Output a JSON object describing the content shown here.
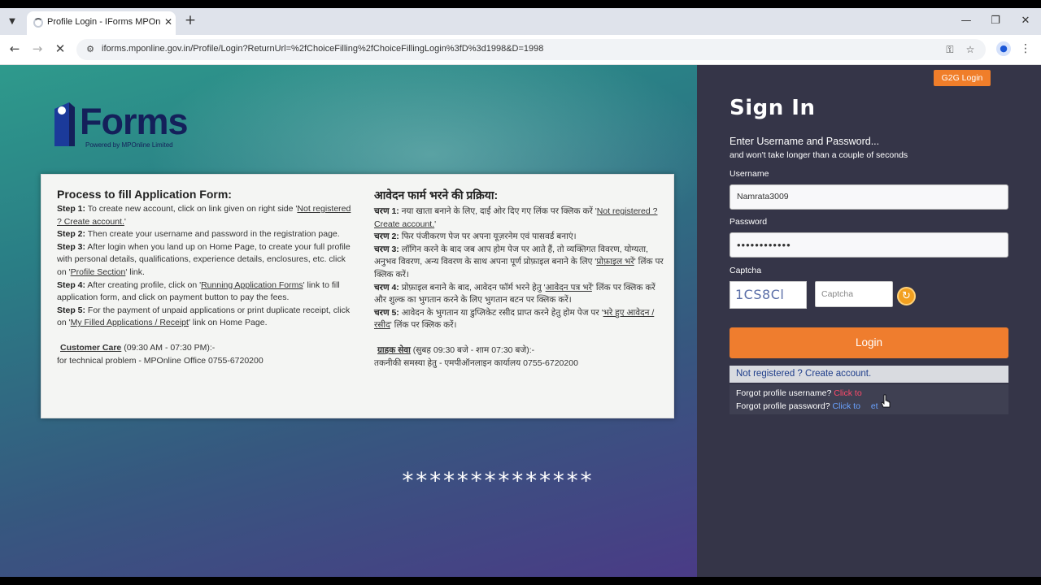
{
  "browser": {
    "tab_title": "Profile Login - IForms MPOnline",
    "tab_close": "✕",
    "new_tab": "+",
    "url": "iforms.mponline.gov.in/Profile/Login?ReturnUrl=%2fChoiceFilling%2fChoiceFillingLogin%3fD%3d1998&D=1998"
  },
  "logo": {
    "text": "Forms",
    "tagline": "Powered by MPOnline Limited",
    "colors": {
      "i_blue": "#1b3a9a",
      "i_dark": "#14205a"
    }
  },
  "instructions_en": {
    "title": "Process to fill Application Form:",
    "step1_label": "Step 1:",
    "step1_text": " To create new account, click on link given on right side '",
    "step1_link": "Not registered ? Create account.",
    "step1_end": "'",
    "step2_label": "Step 2:",
    "step2_text": " Then create your username and password in the registration page.",
    "step3_label": "Step 3:",
    "step3_text": " After login when you land up on Home Page, to create your full profile with personal details, qualifications, experience details, enclosures, etc. click on '",
    "step3_link": "Profile Section",
    "step3_end": "' link.",
    "step4_label": "Step 4:",
    "step4_text": " After creating profile, click on '",
    "step4_link": "Running Application Forms",
    "step4_end": "' link to fill application form, and click on payment button to pay the fees.",
    "step5_label": "Step 5:",
    "step5_text": " For the payment of unpaid applications or print duplicate receipt, click on '",
    "step5_link": "My Filled Applications / Receipt",
    "step5_end": "' link on Home Page.",
    "care_title": "Customer Care",
    "care_hours": " (09:30 AM - 07:30 PM):-",
    "care_line": "for technical problem - MPOnline Office 0755-6720200"
  },
  "instructions_hi": {
    "title": "आवेदन फार्म भरने की प्रक्रिया:",
    "step1_label": "चरण 1:",
    "step1_text": " नया खाता बनाने के लिए, दाईं ओर दिए गए लिंक पर क्लिक करें '",
    "step1_link": "Not registered ? Create account.",
    "step1_end": "'",
    "step2_label": "चरण 2:",
    "step2_text": " फिर पंजीकरण पेज पर अपना यूज़रनेम एवं पासवर्ड बनाएं।",
    "step3_label": "चरण 3:",
    "step3_text": " लॉगिन करने के बाद जब आप होम पेज पर आते हैं, तो व्यक्तिगत विवरण, योग्यता, अनुभव विवरण, अन्य विवरण के साथ अपना पूर्ण प्रोफ़ाइल बनाने के लिए '",
    "step3_link": "प्रोफ़ाइल भरें",
    "step3_end": "' लिंक पर क्लिक करें।",
    "step4_label": "चरण 4:",
    "step4_text": " प्रोफ़ाइल बनाने के बाद, आवेदन फॉर्म भरने हेतु '",
    "step4_link": "आवेदन पत्र भरें",
    "step4_end": "' लिंक पर क्लिक करें और शुल्क का भुगतान करने के लिए भुगतान बटन पर क्लिक करें।",
    "step5_label": "चरण 5:",
    "step5_text": " आवेदन के भुगतान या डुप्लिकेट रसीद प्राप्त करने हेतु होम पेज पर '",
    "step5_link": "भरे हुए आवेदन / रसीद",
    "step5_end": "' लिंक पर क्लिक करें।",
    "care_title": "ग्राहक सेवा",
    "care_hours": " (सुबह 09:30 बजे - शाम 07:30 बजे):-",
    "care_line": "तकनीकी समस्या हेतु - एमपीऑनलाइन कार्यालय 0755-6720200"
  },
  "masked_overlay": "**************",
  "signin": {
    "g2g_label": "G2G Login",
    "title": "Sign In",
    "subtitle1": "Enter Username and Password...",
    "subtitle2": "and won't take longer than a couple of seconds",
    "username_label": "Username",
    "username_value": "Namrata3009",
    "password_label": "Password",
    "password_value": "••••••••••••",
    "captcha_label": "Captcha",
    "captcha_code": "1CS8Cl",
    "captcha_placeholder": "Captcha",
    "login_label": "Login",
    "register_text": "Not registered ? Create account.",
    "forgot_username_text": "Forgot profile username?",
    "forgot_username_link": "Click to ",
    "forgot_password_text": "Forgot profile password?",
    "forgot_password_link": "Click to ",
    "forgot_password_link_end": "et"
  },
  "colors": {
    "accent_orange": "#ef7d2e",
    "panel_dark": "#353548",
    "link_blue": "#1e3d8a"
  }
}
